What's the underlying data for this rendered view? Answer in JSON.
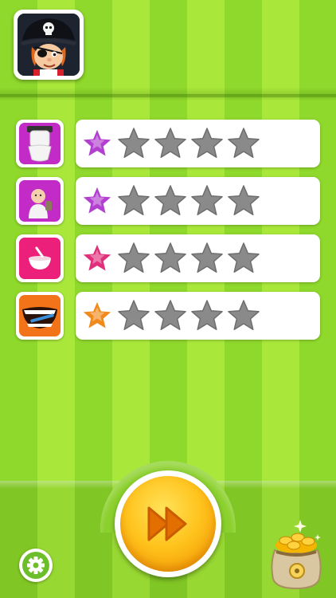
{
  "profile": {
    "avatar_icon": "pirate-avatar-icon"
  },
  "levels": [
    {
      "icon": "toilet-icon",
      "icon_bg": "#c22bc6",
      "rating": 1,
      "max_rating": 5,
      "active_color": "#b23fcf"
    },
    {
      "icon": "baby-icon",
      "icon_bg": "#c22bc6",
      "rating": 1,
      "max_rating": 5,
      "active_color": "#b23fcf"
    },
    {
      "icon": "food-bowl-icon",
      "icon_bg": "#ec1f7a",
      "rating": 1,
      "max_rating": 5,
      "active_color": "#e0307c"
    },
    {
      "icon": "toothbrush-mouth-icon",
      "icon_bg": "#f27318",
      "rating": 1,
      "max_rating": 5,
      "active_color": "#f08a1c"
    }
  ],
  "controls": {
    "play_icon": "fast-forward-icon",
    "settings_icon": "gear-icon",
    "shop_icon": "coin-bag-icon"
  },
  "colors": {
    "stripe_light": "#a9e83a",
    "stripe_dark": "#8fd82c",
    "star_inactive": "#8a8a8a"
  }
}
